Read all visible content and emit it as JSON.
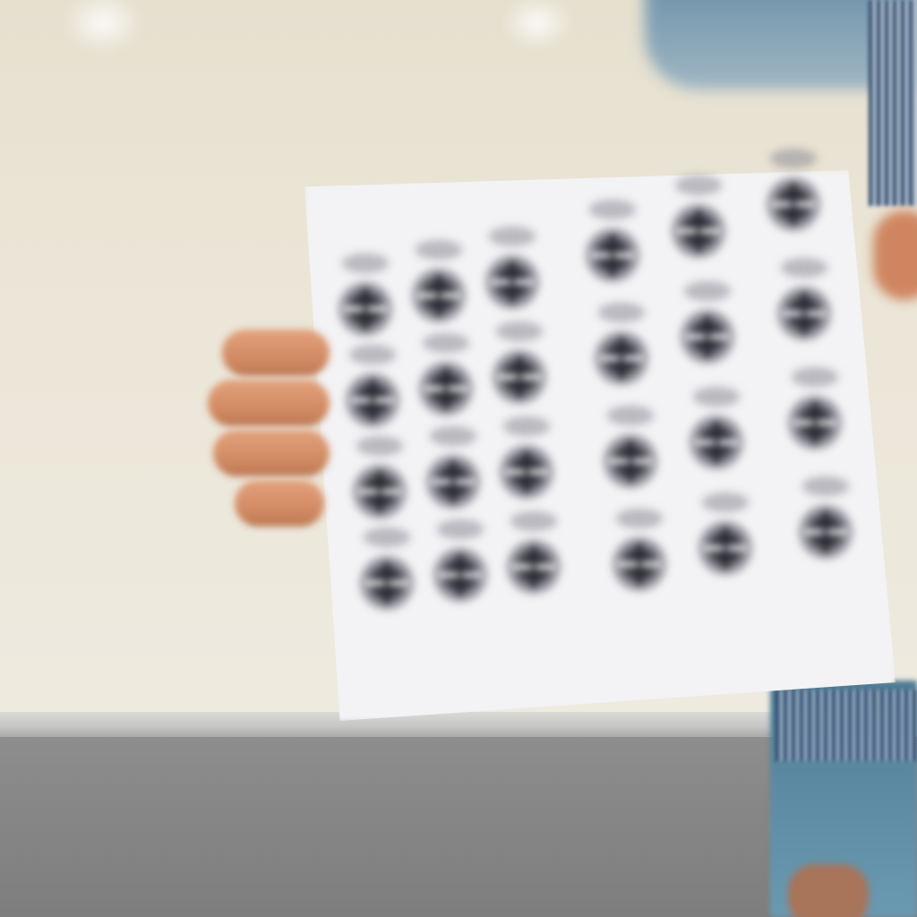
{
  "scene": {
    "kind": "photograph",
    "subject": "hand-holding-printed-marker-sheet",
    "blurred": true
  },
  "colors": {
    "wall": "#e9e4d8",
    "floor": "#858585",
    "ledge": "#c5c5c4",
    "paper": "#f3f2f4",
    "marker_dark": "#2a2a34",
    "skin": "#d4906a",
    "shirt": "#5b8aa2",
    "shirt_stripe": "#2b3e62"
  },
  "markers": {
    "columns": 6,
    "rows": 4
  }
}
